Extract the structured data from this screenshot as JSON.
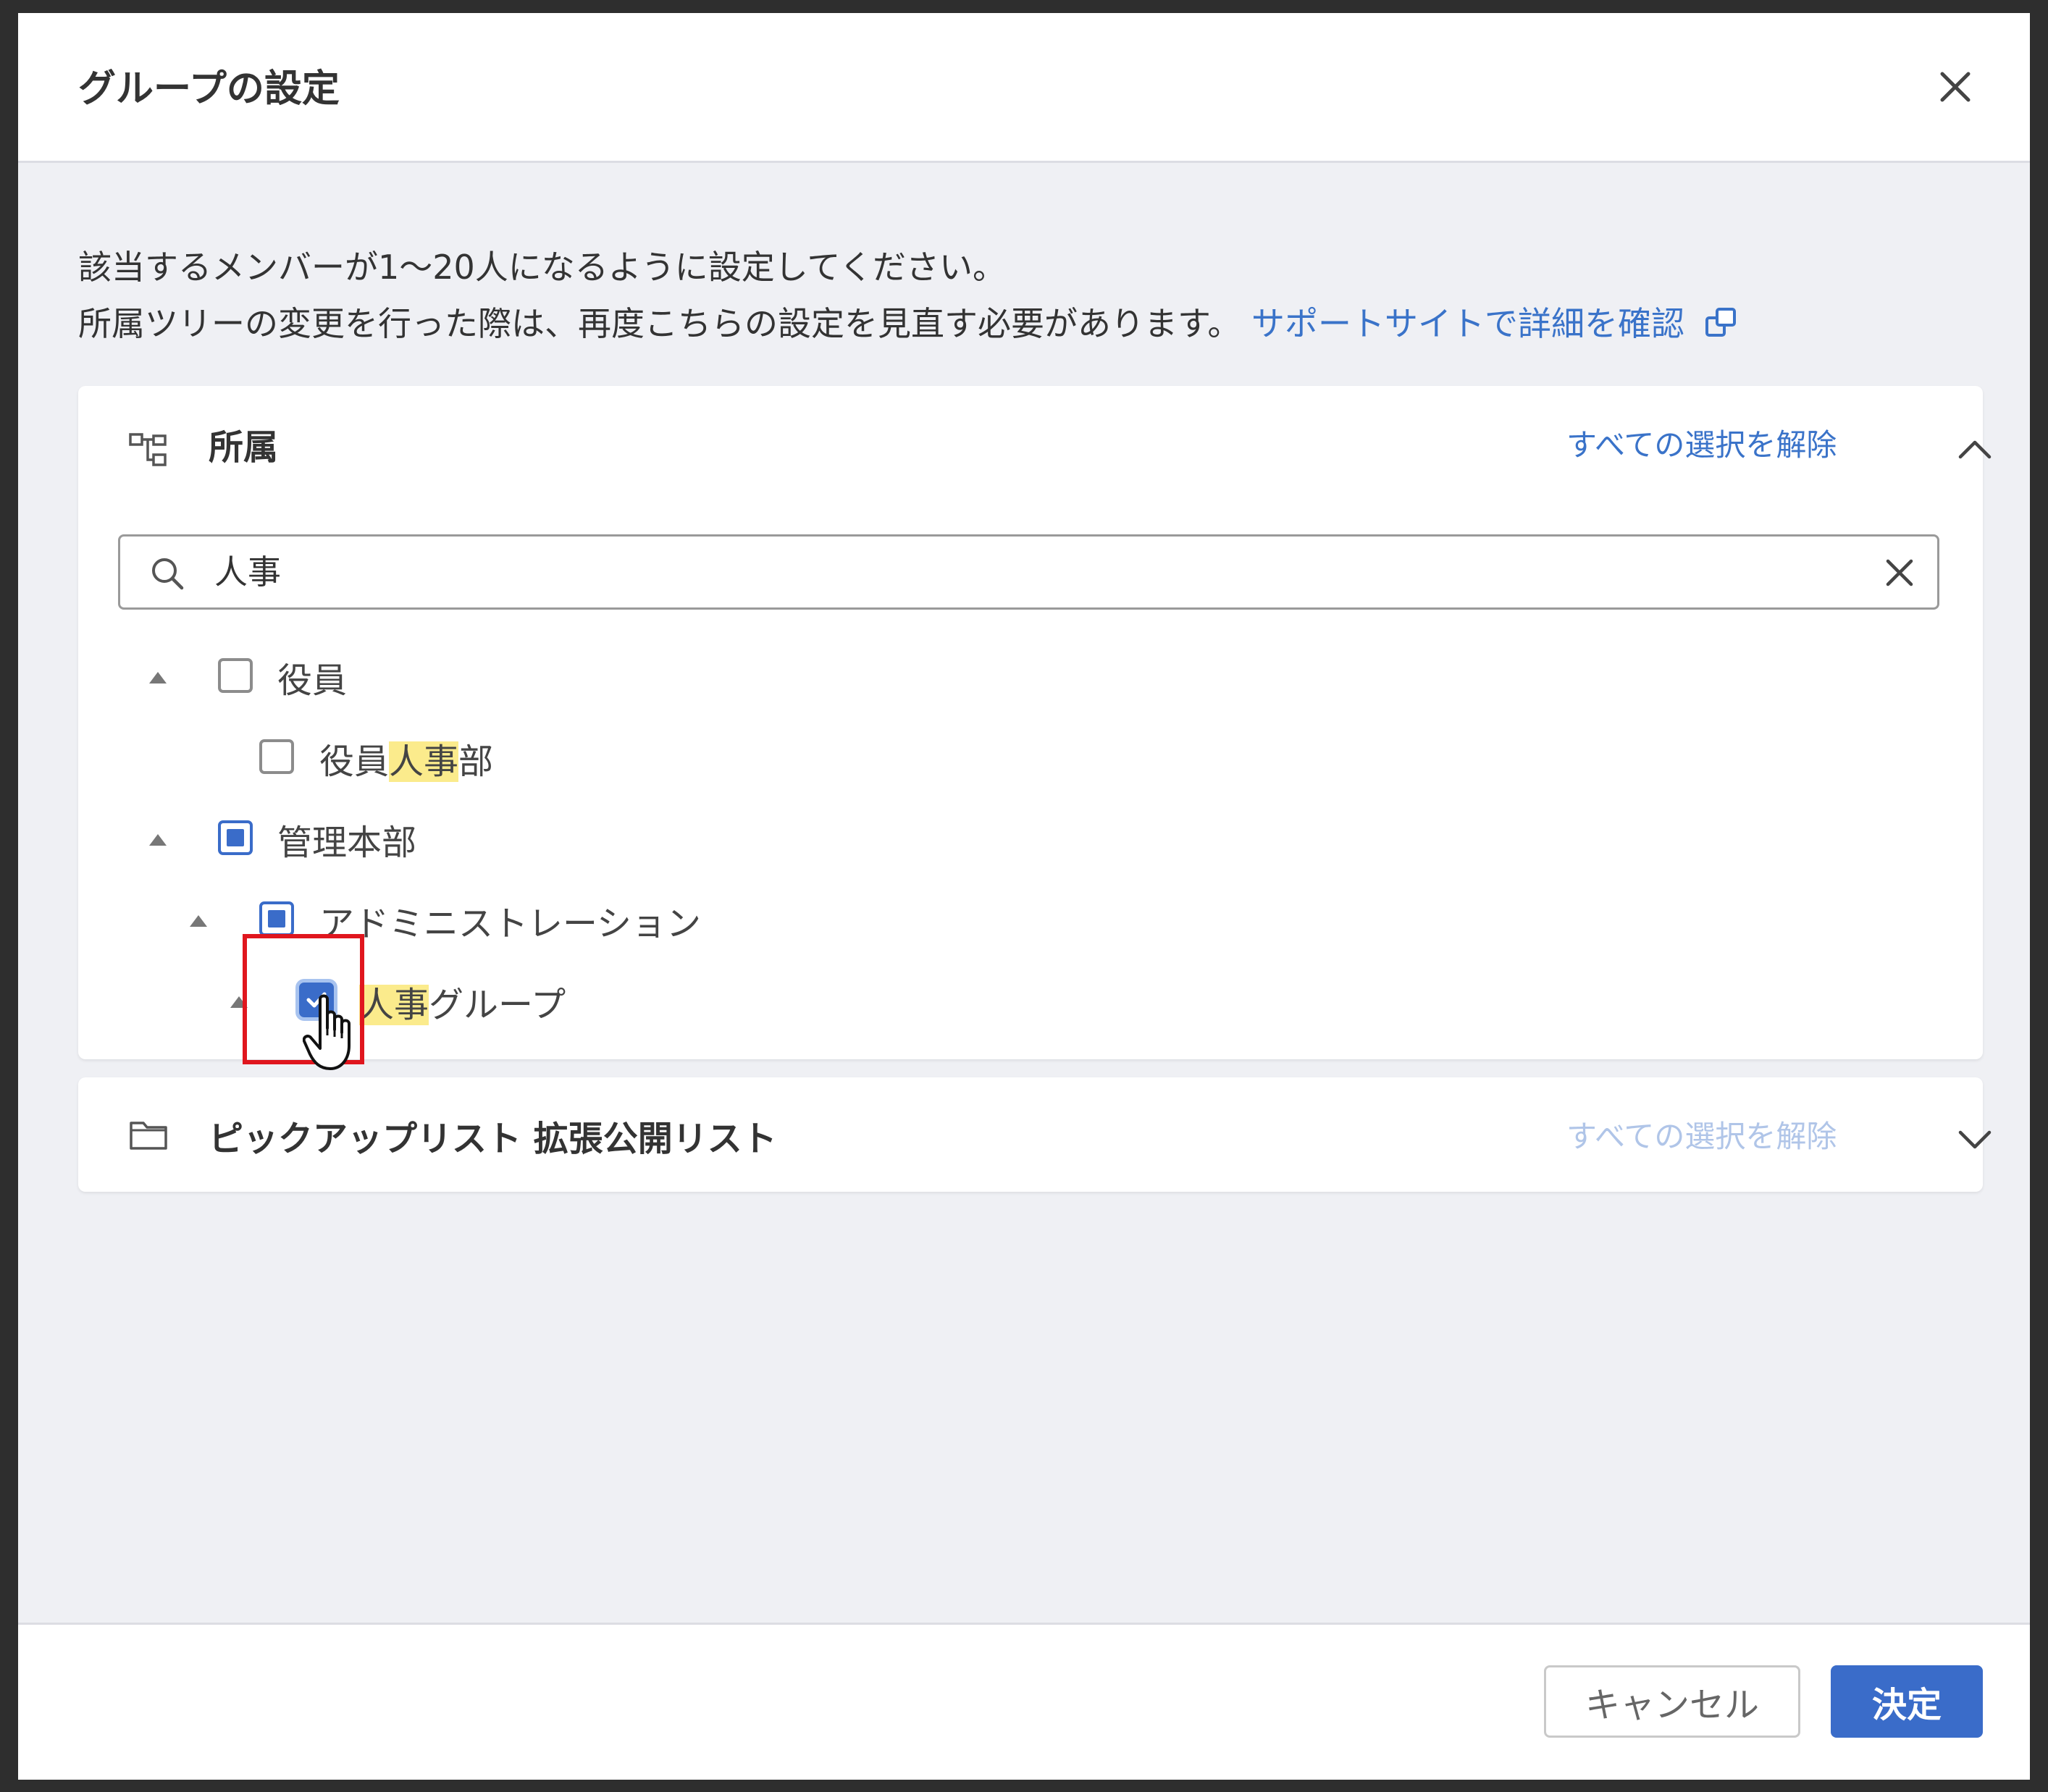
{
  "dialog": {
    "title": "グループの設定",
    "intro_line1": "該当するメンバーが1〜20人になるように設定してください。",
    "intro_line2": "所属ツリーの変更を行った際は、再度こちらの設定を見直す必要があります。",
    "support_link": "サポートサイトで詳細を確認"
  },
  "org_panel": {
    "title": "所属",
    "clear_label": "すべての選択を解除",
    "expanded": true,
    "search": {
      "value": "人事",
      "highlight": "人事"
    },
    "tree": [
      {
        "label": "役員",
        "state": "unchecked",
        "level": 0,
        "caret": true
      },
      {
        "label_pre": "役員",
        "label_hl": "人事",
        "label_post": "部",
        "state": "unchecked",
        "level": 1,
        "caret": false
      },
      {
        "label": "管理本部",
        "state": "partial",
        "level": 0,
        "caret": true
      },
      {
        "label": "アドミニストレーション",
        "state": "partial",
        "level": 1,
        "caret": true
      },
      {
        "label_pre": "",
        "label_hl": "人事",
        "label_post": "グループ",
        "state": "checked",
        "level": 2,
        "caret": true
      }
    ]
  },
  "picklist_panel": {
    "title": "ピックアップリスト 拡張公開リスト",
    "clear_label": "すべての選択を解除",
    "expanded": false
  },
  "footer": {
    "cancel_label": "キャンセル",
    "ok_label": "決定"
  },
  "colors": {
    "accent": "#3a6cc9",
    "link": "#3a73c9",
    "highlight": "#fbeb8c",
    "focus_outline": "#e0161e"
  }
}
